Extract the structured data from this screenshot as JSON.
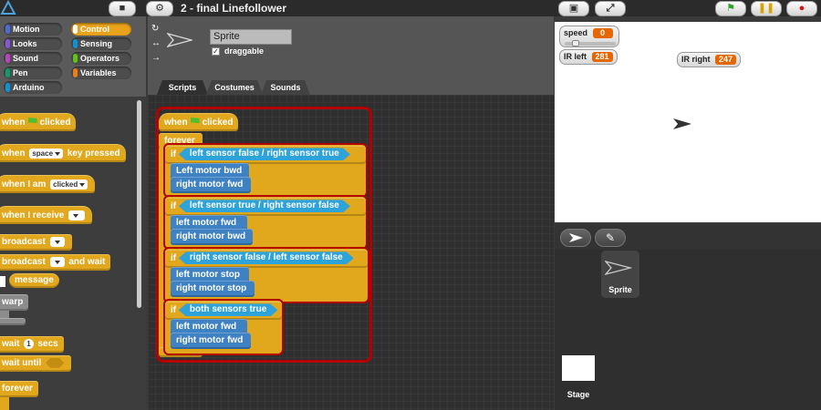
{
  "window": {
    "title": "2 - final Linefollower"
  },
  "categories": [
    {
      "label": "Motion",
      "color": "#4a6cd4"
    },
    {
      "label": "Control",
      "color": "#e1a81d",
      "selected": true
    },
    {
      "label": "Looks",
      "color": "#8a55d7"
    },
    {
      "label": "Sensing",
      "color": "#0a94d6"
    },
    {
      "label": "Sound",
      "color": "#bb42c3"
    },
    {
      "label": "Operators",
      "color": "#62c213"
    },
    {
      "label": "Pen",
      "color": "#0e9a6c"
    },
    {
      "label": "Variables",
      "color": "#ee7d16"
    },
    {
      "label": "Arduino",
      "color": "#0a94d6"
    }
  ],
  "palette": {
    "when_flag": "when",
    "clicked": "clicked",
    "when_key": "when",
    "key_value": "space",
    "key_pressed": "key pressed",
    "when_i_am": "when I am",
    "i_am_value": "clicked",
    "when_receive": "when I receive",
    "broadcast": "broadcast",
    "broadcast_wait": "broadcast",
    "and_wait": "and wait",
    "message": "message",
    "warp": "warp",
    "wait": "wait",
    "wait_value": "1",
    "secs": "secs",
    "wait_until": "wait until",
    "forever": "forever"
  },
  "sprite": {
    "name": "Sprite",
    "draggable_label": "draggable",
    "draggable_checked": "✓"
  },
  "tabs": [
    {
      "label": "Scripts",
      "selected": true
    },
    {
      "label": "Costumes"
    },
    {
      "label": "Sounds"
    }
  ],
  "script": {
    "hat_when": "when",
    "hat_clicked": "clicked",
    "forever": "forever",
    "if": "if",
    "cond1": "left sensor false / right sensor true",
    "cond1_a": "Left motor bwd",
    "cond1_b": "right motor fwd",
    "cond2": "left sensor true / right sensor false",
    "cond2_a": "left motor fwd",
    "cond2_b": "right motor bwd",
    "cond3": "right sensor false / left sensor false",
    "cond3_a": "left motor stop",
    "cond3_b": "right motor stop",
    "cond4": "both sensors true",
    "cond4_a": "left motor fwd",
    "cond4_b": "right motor fwd"
  },
  "stage": {
    "watchers": [
      {
        "label": "speed",
        "value": "0"
      },
      {
        "label": "IR left",
        "value": "281"
      },
      {
        "label": "IR right",
        "value": "247"
      }
    ]
  },
  "corral": {
    "sprite_label": "Sprite",
    "stage_label": "Stage"
  }
}
